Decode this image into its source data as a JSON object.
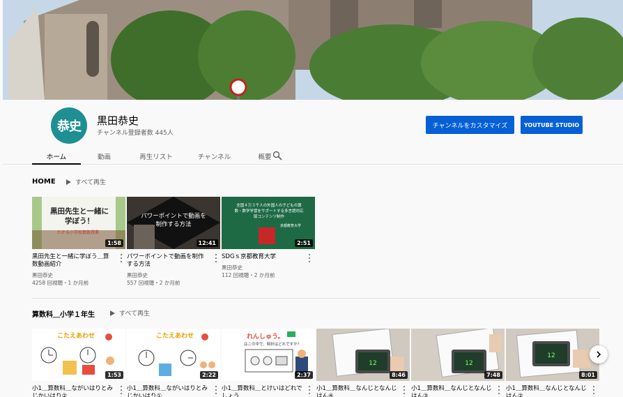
{
  "channel": {
    "avatar_text": "恭史",
    "name": "黒田恭史",
    "subscribers": "チャンネル登録者数 445人",
    "customize_button": "チャンネルをカスタマイズ",
    "studio_button": "YOUTUBE STUDIO",
    "avatar_color": "#1e8f93",
    "accent": "#065fd4"
  },
  "tabs": [
    {
      "label": "ホーム"
    },
    {
      "label": "動画"
    },
    {
      "label": "再生リスト"
    },
    {
      "label": "チャンネル"
    },
    {
      "label": "概要"
    }
  ],
  "search_icon": "search-icon",
  "home_section": {
    "title": "HOME",
    "play_all": "すべて再生",
    "videos": [
      {
        "thumb_text": "黒田先生と一緒に学ぼう！",
        "thumb_sub": "わかる小学校算数授業",
        "duration": "1:58",
        "title": "黒田先生と一緒に学ぼう＿算数動画紹介",
        "channel": "黒田恭史",
        "meta": "4258 回視聴・1 か月前"
      },
      {
        "thumb_text": "パワーポイントで動画を制作する方法",
        "duration": "12:41",
        "title": "パワーポイントで動画を制作する方法",
        "channel": "黒田恭史",
        "meta": "557 回視聴・2 か月前"
      },
      {
        "thumb_text": "全国４万３千人の外国人の子どもの算数・数学学習をサポートする多言語対応版コンテンツ制作",
        "thumb_sub": "京都教育大学",
        "duration": "2:51",
        "title": "SDGｓ京都教育大学",
        "channel": "黒田恭史",
        "meta": "112 回視聴・2 か月前"
      }
    ]
  },
  "math_section": {
    "title": "算数科＿小学１年生",
    "play_all": "すべて再生",
    "videos": [
      {
        "thumb_text": "こたえあわせ",
        "duration": "1:53",
        "title": "小1＿算数科＿ながいはりとみじかいはり②"
      },
      {
        "thumb_text": "こたえあわせ",
        "duration": "2:22",
        "title": "小1＿算数科＿ながいはりとみじかいはり①"
      },
      {
        "thumb_text": "れんしゅう。",
        "thumb_sub": "はこの中で、時計はどれですか？",
        "duration": "2:37",
        "title": "小1＿算数科＿とけいはどれでしょう"
      },
      {
        "duration": "8:46",
        "title": "小1＿算数科＿なんじとなんじはん④"
      },
      {
        "duration": "7:48",
        "title": "小1＿算数科＿なんじとなんじはん③"
      },
      {
        "duration": "8:01",
        "title": "小1＿算数科＿なんじとなんじはん②"
      }
    ]
  },
  "next_icon": "chevron-right-icon"
}
